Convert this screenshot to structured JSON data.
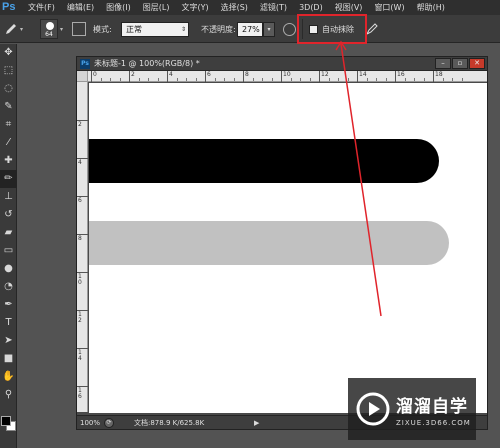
{
  "app": {
    "logo": "Ps"
  },
  "menu": [
    "文件(F)",
    "编辑(E)",
    "图像(I)",
    "图层(L)",
    "文字(Y)",
    "选择(S)",
    "滤镜(T)",
    "3D(D)",
    "视图(V)",
    "窗口(W)",
    "帮助(H)"
  ],
  "options": {
    "brush_size": "64",
    "mode_label": "模式:",
    "mode_value": "正常",
    "opacity_label": "不透明度:",
    "opacity_value": "27%",
    "auto_erase_label": "自动抹除",
    "auto_erase_checked": false
  },
  "tools": [
    "move-tool",
    "marquee-tool",
    "lasso-tool",
    "quick-select-tool",
    "crop-tool",
    "eyedropper-tool",
    "healing-tool",
    "pencil-tool",
    "clone-stamp-tool",
    "history-brush-tool",
    "eraser-tool",
    "gradient-tool",
    "blur-tool",
    "dodge-tool",
    "pen-tool",
    "type-tool",
    "path-select-tool",
    "rectangle-tool",
    "hand-tool",
    "zoom-tool"
  ],
  "document": {
    "title": "未标题-1 @ 100%(RGB/8) *",
    "zoom": "100%",
    "doc_info": "文档:878.9 K/625.8K",
    "ruler_top": [
      "0",
      "2",
      "4",
      "6",
      "8",
      "10",
      "12",
      "14",
      "16",
      "18"
    ],
    "ruler_left": [
      "2",
      "4",
      "6",
      "8",
      "10",
      "12",
      "14",
      "16"
    ]
  },
  "strokes": [
    {
      "name": "black-stroke",
      "color": "#000000"
    },
    {
      "name": "gray-stroke",
      "color": "#c1c1c1"
    }
  ],
  "annotation": {
    "color": "#e0242b"
  },
  "watermark": {
    "brand": "溜溜自学",
    "url": "ZIXUE.3D66.COM"
  }
}
